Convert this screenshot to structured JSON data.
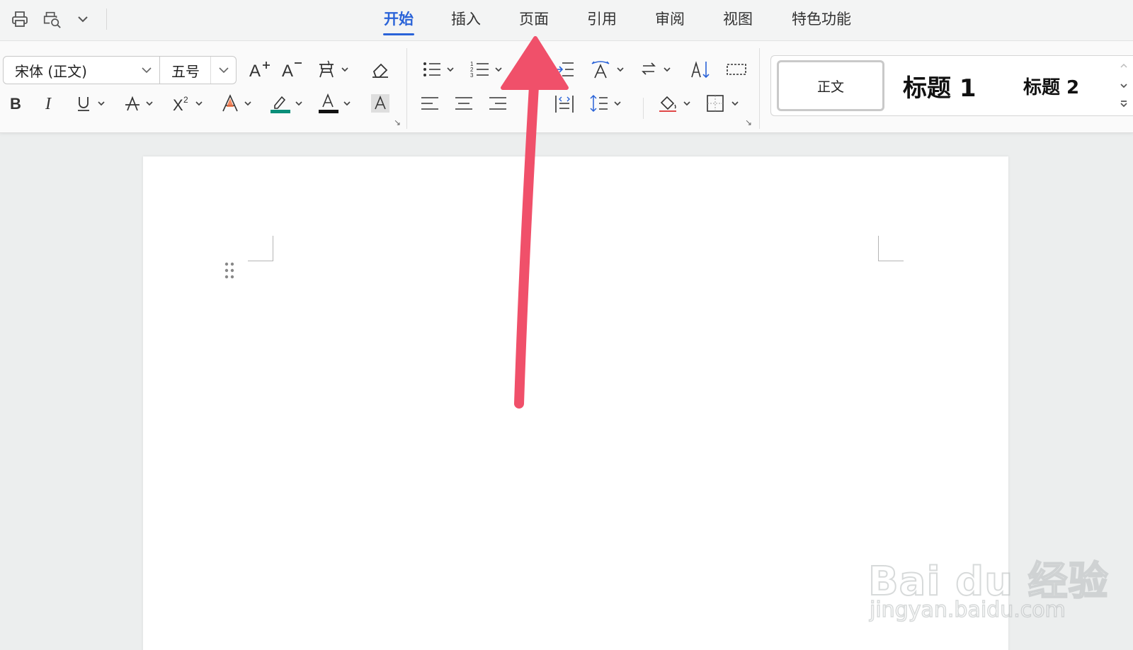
{
  "tabs": [
    {
      "label": "开始",
      "active": true
    },
    {
      "label": "插入",
      "active": false
    },
    {
      "label": "页面",
      "active": false
    },
    {
      "label": "引用",
      "active": false
    },
    {
      "label": "审阅",
      "active": false
    },
    {
      "label": "视图",
      "active": false
    },
    {
      "label": "特色功能",
      "active": false
    }
  ],
  "quick_access": {
    "icons": [
      "print-icon",
      "print-preview-icon",
      "customize-chevron-icon"
    ]
  },
  "ribbon": {
    "font_name": "宋体 (正文)",
    "font_size": "五号",
    "font_color": "#111111",
    "highlight_color": "#0a8f7a"
  },
  "styles": {
    "normal": "正文",
    "heading1": "标题  1",
    "heading2": "标题  2"
  },
  "watermark": {
    "brand": "Bai du 经验",
    "url": "jingyan.baidu.com"
  },
  "colors": {
    "accent": "#2a63d8",
    "annotation_arrow": "#f0506a"
  }
}
